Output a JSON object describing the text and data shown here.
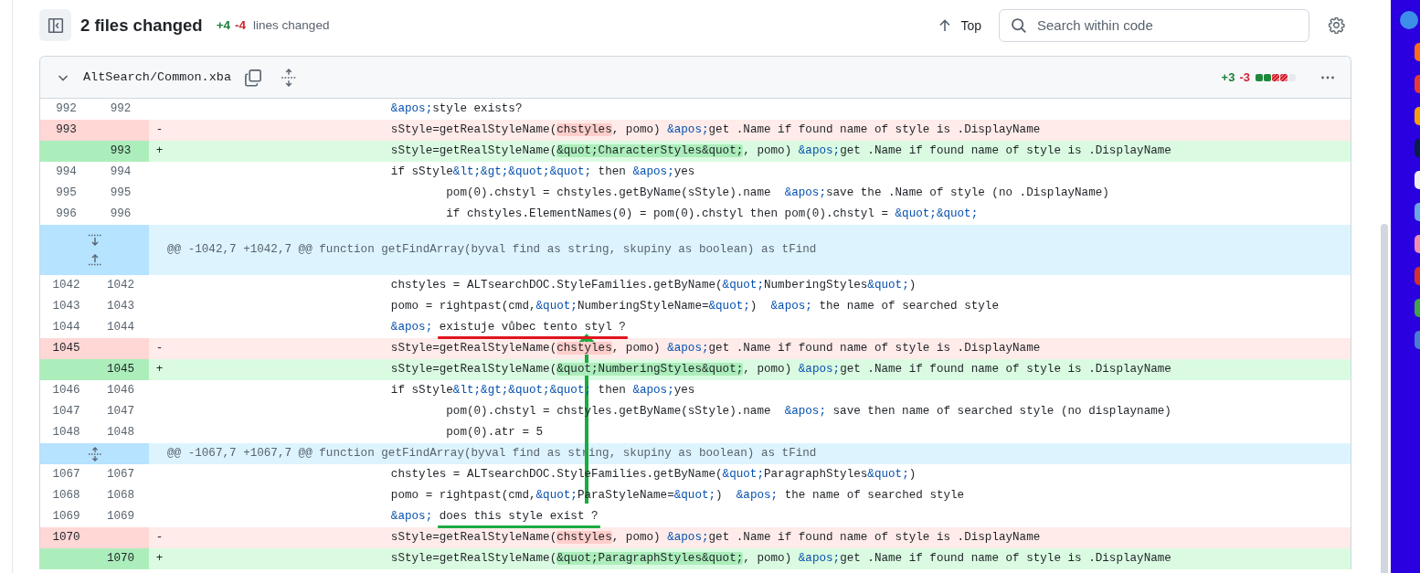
{
  "toolbar": {
    "title": "2 files changed",
    "additions": "+4",
    "deletions": "-4",
    "label": "lines changed",
    "top_button": "Top",
    "search": {
      "placeholder": "Search within code"
    }
  },
  "file": {
    "name": "AltSearch/Common.xba",
    "expanded": true,
    "additions": "+3",
    "deletions": "-3",
    "diffstat": [
      {
        "kind": "added"
      },
      {
        "kind": "added"
      },
      {
        "kind": "deleted"
      },
      {
        "kind": "deleted"
      },
      {
        "kind": "neutral"
      }
    ]
  },
  "rows": [
    {
      "kind": "context",
      "old": "992",
      "new": "992",
      "tokens": [
        {
          "t": "                                &apos;",
          "kind": "entity"
        },
        {
          "t": "style exists?",
          "kind": "plain"
        }
      ]
    },
    {
      "kind": "del",
      "old": "993",
      "marker": "-",
      "tokens": [
        {
          "t": "                                sStyle=getRealStyleName(",
          "kind": "plain"
        },
        {
          "t": "chstyles",
          "kind": "changed"
        },
        {
          "t": ", pomo) ",
          "kind": "plain"
        },
        {
          "t": "&apos;",
          "kind": "entity"
        },
        {
          "t": "get .Name if found name of style is .DisplayName",
          "kind": "plain"
        }
      ]
    },
    {
      "kind": "add",
      "new": "993",
      "marker": "+",
      "tokens": [
        {
          "t": "                                sStyle=getRealStyleName(",
          "kind": "plain"
        },
        {
          "t": "&quot;CharacterStyles&quot;",
          "kind": "changed"
        },
        {
          "t": ", pomo) ",
          "kind": "plain"
        },
        {
          "t": "&apos;",
          "kind": "entity"
        },
        {
          "t": "get .Name if found name of style is .DisplayName",
          "kind": "plain"
        }
      ]
    },
    {
      "kind": "context",
      "old": "994",
      "new": "994",
      "tokens": [
        {
          "t": "                                if sStyle",
          "kind": "plain"
        },
        {
          "t": "&lt;&gt;&quot;&quot;",
          "kind": "entity"
        },
        {
          "t": " then ",
          "kind": "plain"
        },
        {
          "t": "&apos;",
          "kind": "entity"
        },
        {
          "t": "yes",
          "kind": "plain"
        }
      ]
    },
    {
      "kind": "context",
      "old": "995",
      "new": "995",
      "tokens": [
        {
          "t": "                                        pom(0).chstyl = chstyles.getByName(sStyle).name  ",
          "kind": "plain"
        },
        {
          "t": "&apos;",
          "kind": "entity"
        },
        {
          "t": "save the .Name of style (no .DisplayName)",
          "kind": "plain"
        }
      ]
    },
    {
      "kind": "context",
      "old": "996",
      "new": "996",
      "tokens": [
        {
          "t": "                                        if chstyles.ElementNames(0) = pom(0).chstyl then pom(0).chstyl = ",
          "kind": "plain"
        },
        {
          "t": "&quot;&quot;",
          "kind": "entity"
        }
      ]
    },
    {
      "kind": "hunk",
      "expanders": [
        {
          "kind": "down"
        },
        {
          "kind": "up"
        }
      ],
      "text": "@@ -1042,7 +1042,7 @@ function getFindArray(byval find as string, skupiny as boolean) as tFind"
    },
    {
      "kind": "context",
      "old": "1042",
      "new": "1042",
      "tokens": [
        {
          "t": "                                chstyles = ALTsearchDOC.StyleFamilies.getByName(",
          "kind": "plain"
        },
        {
          "t": "&quot;",
          "kind": "entity"
        },
        {
          "t": "NumberingStyles",
          "kind": "plain"
        },
        {
          "t": "&quot;",
          "kind": "entity"
        },
        {
          "t": ")",
          "kind": "plain"
        }
      ]
    },
    {
      "kind": "context",
      "old": "1043",
      "new": "1043",
      "tokens": [
        {
          "t": "                                pomo = rightpast(cmd,",
          "kind": "plain"
        },
        {
          "t": "&quot;",
          "kind": "entity"
        },
        {
          "t": "NumberingStyleName=",
          "kind": "plain"
        },
        {
          "t": "&quot;",
          "kind": "entity"
        },
        {
          "t": ")  ",
          "kind": "plain"
        },
        {
          "t": "&apos;",
          "kind": "entity"
        },
        {
          "t": " the name of searched style",
          "kind": "plain"
        }
      ]
    },
    {
      "kind": "context",
      "old": "1044",
      "new": "1044",
      "tokens": [
        {
          "t": "                                &apos; ",
          "kind": "entity"
        },
        {
          "t": "existuje vůbec tento styl ?",
          "kind": "underlined",
          "color": "#e0141e"
        }
      ]
    },
    {
      "kind": "del",
      "old": "1045",
      "marker": "-",
      "tokens": [
        {
          "t": "                                sStyle=getRealStyleName(",
          "kind": "plain"
        },
        {
          "t": "chstyles",
          "kind": "changed"
        },
        {
          "t": ", pomo) ",
          "kind": "plain"
        },
        {
          "t": "&apos;",
          "kind": "entity"
        },
        {
          "t": "get .Name if found name of style is .DisplayName",
          "kind": "plain"
        }
      ]
    },
    {
      "kind": "add",
      "new": "1045",
      "marker": "+",
      "tokens": [
        {
          "t": "                                sStyle=getRealStyleName(",
          "kind": "plain"
        },
        {
          "t": "&quot;NumberingStyles&quot;",
          "kind": "changed"
        },
        {
          "t": ", pomo) ",
          "kind": "plain"
        },
        {
          "t": "&apos;",
          "kind": "entity"
        },
        {
          "t": "get .Name if found name of style is .DisplayName",
          "kind": "plain"
        }
      ]
    },
    {
      "kind": "context",
      "old": "1046",
      "new": "1046",
      "tokens": [
        {
          "t": "                                if sStyle",
          "kind": "plain"
        },
        {
          "t": "&lt;&gt;&quot;&quot;",
          "kind": "entity"
        },
        {
          "t": " then ",
          "kind": "plain"
        },
        {
          "t": "&apos;",
          "kind": "entity"
        },
        {
          "t": "yes",
          "kind": "plain"
        }
      ]
    },
    {
      "kind": "context",
      "old": "1047",
      "new": "1047",
      "tokens": [
        {
          "t": "                                        pom(0).chstyl = chstyles.getByName(sStyle).name  ",
          "kind": "plain"
        },
        {
          "t": "&apos;",
          "kind": "entity"
        },
        {
          "t": " save then name of searched style (no displayname)",
          "kind": "plain"
        }
      ]
    },
    {
      "kind": "context",
      "old": "1048",
      "new": "1048",
      "tokens": [
        {
          "t": "                                        pom(0).atr = 5",
          "kind": "plain"
        }
      ]
    },
    {
      "kind": "hunk",
      "expanders": [
        {
          "kind": "both"
        }
      ],
      "text": "@@ -1067,7 +1067,7 @@ function getFindArray(byval find as string, skupiny as boolean) as tFind"
    },
    {
      "kind": "context",
      "old": "1067",
      "new": "1067",
      "tokens": [
        {
          "t": "                                chstyles = ALTsearchDOC.StyleFamilies.getByName(",
          "kind": "plain"
        },
        {
          "t": "&quot;",
          "kind": "entity"
        },
        {
          "t": "ParagraphStyles",
          "kind": "plain"
        },
        {
          "t": "&quot;",
          "kind": "entity"
        },
        {
          "t": ")",
          "kind": "plain"
        }
      ]
    },
    {
      "kind": "context",
      "old": "1068",
      "new": "1068",
      "tokens": [
        {
          "t": "                                pomo = rightpast(cmd,",
          "kind": "plain"
        },
        {
          "t": "&quot;",
          "kind": "entity"
        },
        {
          "t": "ParaStyleName=",
          "kind": "plain"
        },
        {
          "t": "&quot;",
          "kind": "entity"
        },
        {
          "t": ")  ",
          "kind": "plain"
        },
        {
          "t": "&apos;",
          "kind": "entity"
        },
        {
          "t": " the name of searched style",
          "kind": "plain"
        }
      ]
    },
    {
      "kind": "context",
      "old": "1069",
      "new": "1069",
      "tokens": [
        {
          "t": "                                &apos; ",
          "kind": "entity"
        },
        {
          "t": "does this style exist ?",
          "kind": "underlined",
          "color": "#1aab40"
        }
      ]
    },
    {
      "kind": "del",
      "old": "1070",
      "marker": "-",
      "tokens": [
        {
          "t": "                                sStyle=getRealStyleName(",
          "kind": "plain"
        },
        {
          "t": "chstyles",
          "kind": "changed"
        },
        {
          "t": ", pomo) ",
          "kind": "plain"
        },
        {
          "t": "&apos;",
          "kind": "entity"
        },
        {
          "t": "get .Name if found name of style is .DisplayName",
          "kind": "plain"
        }
      ]
    },
    {
      "kind": "add",
      "new": "1070",
      "marker": "+",
      "tokens": [
        {
          "t": "                                sStyle=getRealStyleName(",
          "kind": "plain"
        },
        {
          "t": "&quot;ParagraphStyles&quot;",
          "kind": "changed"
        },
        {
          "t": ", pomo) ",
          "kind": "plain"
        },
        {
          "t": "&apos;",
          "kind": "entity"
        },
        {
          "t": "get .Name if found name of style is .DisplayName",
          "kind": "plain"
        }
      ]
    }
  ],
  "annotations": [
    {
      "kind": "arrow",
      "color": "#1aab40"
    }
  ]
}
